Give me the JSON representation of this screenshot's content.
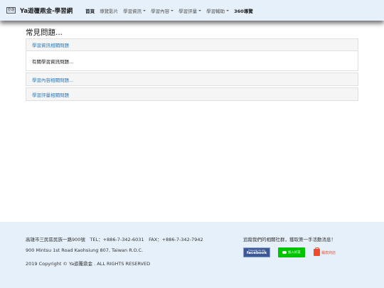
{
  "header": {
    "logo_text": "亞遊",
    "brand": "Ya遊覆鼎金-學習網",
    "nav": [
      {
        "label": "首頁",
        "dropdown": false
      },
      {
        "label": "導覽影片",
        "dropdown": false
      },
      {
        "label": "學習資訊",
        "dropdown": true
      },
      {
        "label": "學習內容",
        "dropdown": true
      },
      {
        "label": "學習評量",
        "dropdown": true
      },
      {
        "label": "學習輔助",
        "dropdown": true
      },
      {
        "label": "360導覽",
        "dropdown": false
      }
    ]
  },
  "main": {
    "title": "常見問題...",
    "sections": [
      {
        "header": "學習資訊相關問題",
        "body": "有關學習資訊問題..."
      },
      {
        "header": "學習內容相關問題..."
      },
      {
        "header": "學習評量相關問題"
      }
    ]
  },
  "footer": {
    "address_zh": "高雄市三民區民族一路900號　TEL：+886-7-342-6031　FAX：+886-7-342-7942",
    "address_en": "900 Mintsu 1st Road Kaohsiung 807, Taiwan R.O.C.",
    "copyright": "2019 Copyright © Ya遊覆鼎金 . ALL RIGHTS RESERVED",
    "social_prompt": "追蹤我們的相關社群，獲取第一手活動消息！",
    "facebook_label": "facebook",
    "facebook_sub": "FOLLOW US ON",
    "line_label": "加入好友",
    "shop_label": "蝦皮商店"
  },
  "colors": {
    "nav_bg": "#e6f0fa",
    "link": "#337ab7",
    "facebook": "#3b5998",
    "line": "#00c300",
    "shopee": "#ee4d2d"
  }
}
